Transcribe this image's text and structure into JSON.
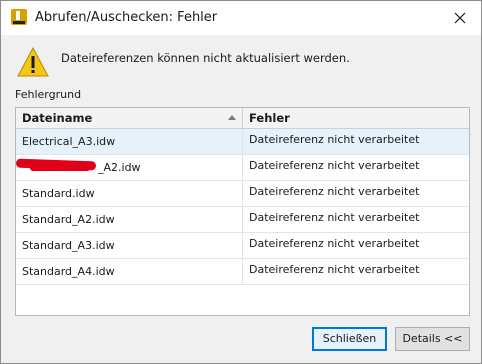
{
  "window": {
    "title": "Abrufen/Auschecken: Fehler"
  },
  "message": {
    "text": "Dateireferenzen können nicht aktualisiert werden."
  },
  "section_label": "Fehlergrund",
  "table": {
    "columns": [
      "Dateiname",
      "Fehler"
    ],
    "rows": [
      {
        "file": "Electrical_A3.idw",
        "error": "Dateireferenz nicht verarbeitet"
      },
      {
        "file": "_A2.idw",
        "error": "Dateireferenz nicht verarbeitet"
      },
      {
        "file": "Standard.idw",
        "error": "Dateireferenz nicht verarbeitet"
      },
      {
        "file": "Standard_A2.idw",
        "error": "Dateireferenz nicht verarbeitet"
      },
      {
        "file": "Standard_A3.idw",
        "error": "Dateireferenz nicht verarbeitet"
      },
      {
        "file": "Standard_A4.idw",
        "error": "Dateireferenz nicht verarbeitet"
      }
    ]
  },
  "buttons": {
    "close": "Schließen",
    "details": "Details <<"
  },
  "colors": {
    "accent": "#0078d7",
    "selected_row": "#e5f1fb",
    "warning": "#f5c518",
    "redaction": "#e0001a"
  }
}
